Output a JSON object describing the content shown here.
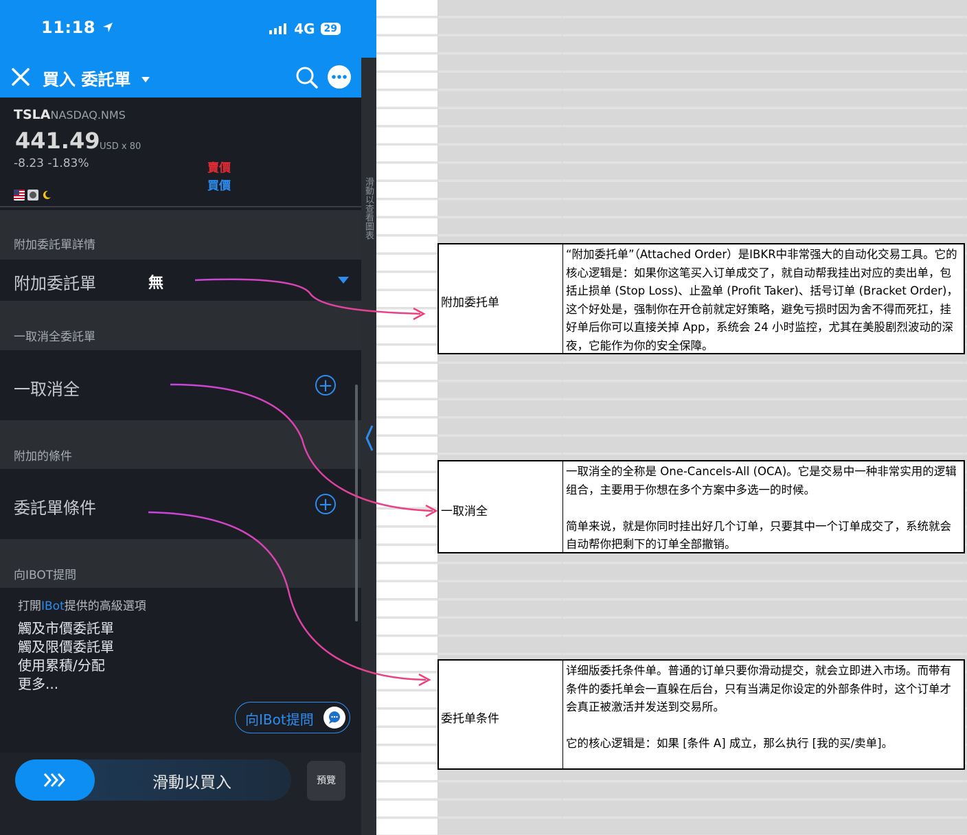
{
  "status_bar": {
    "time": "11:18",
    "network": "4G",
    "battery": "29"
  },
  "nav": {
    "title": "買入 委託單"
  },
  "side_strip": {
    "label": "滑動以查看圖表"
  },
  "quote": {
    "symbol": "TSLA",
    "exchange": "NASDAQ.NMS",
    "price": "441.49",
    "currency": "USD x 80",
    "change": "-8.23  -1.83%",
    "sell_label": "賣價",
    "buy_label": "買價"
  },
  "sections": {
    "attached_details_header": "附加委託單詳情",
    "attached_label": "附加委託單",
    "attached_value": "無",
    "oca_header": "一取消全委託單",
    "oca_label": "一取消全",
    "conditions_header": "附加的條件",
    "conditions_label": "委託單條件",
    "ibot_header": "向IBOT提問"
  },
  "ibot": {
    "intro_prefix": "打開",
    "intro_link": "IBot",
    "intro_suffix": "提供的高級選項",
    "options": [
      "觸及市價委託單",
      "觸及限價委託單",
      "使用累積/分配",
      "更多..."
    ],
    "button_label": "向IBot提問"
  },
  "bottom": {
    "slide_label": "滑動以買入",
    "preview_label": "預覽"
  },
  "notes": [
    {
      "key": "附加委托单",
      "text": "“附加委托单”（Attached Order）是IBKR中非常强大的自动化交易工具。它的核心逻辑是：如果你这笔买入订单成交了，就自动帮我挂出对应的卖出单，包括止损单 (Stop Loss)、止盈单 (Profit Taker)、括号订单 (Bracket Order)，这个好处是，强制你在开仓前就定好策略，避免亏损时因为舍不得而死扛，挂好单后你可以直接关掉 App，系统会 24 小时监控，尤其在美股剧烈波动的深夜，它能作为你的安全保障。"
    },
    {
      "key": "一取消全",
      "text": "一取消全的全称是 One-Cancels-All (OCA)。它是交易中一种非常实用的逻辑组合，主要用于你想在多个方案中多选一的时候。\n\n简单来说，就是你同时挂出好几个订单，只要其中一个订单成交了，系统就会自动帮你把剩下的订单全部撤销。"
    },
    {
      "key": "委托单条件",
      "text": "详细版委托条件单。普通的订单只要你滑动提交，就会立即进入市场。而带有条件的委托单会一直躲在后台，只有当满足你设定的外部条件时，这个订单才会真正被激活并发送到交易所。\n\n它的核心逻辑是：如果 [条件 A] 成立，那么执行 [我的买/卖单]。"
    }
  ],
  "colors": {
    "brand_blue": "#0d8ef2",
    "sell_red": "#e02b35",
    "arrow_pink": "#e83c8a"
  }
}
